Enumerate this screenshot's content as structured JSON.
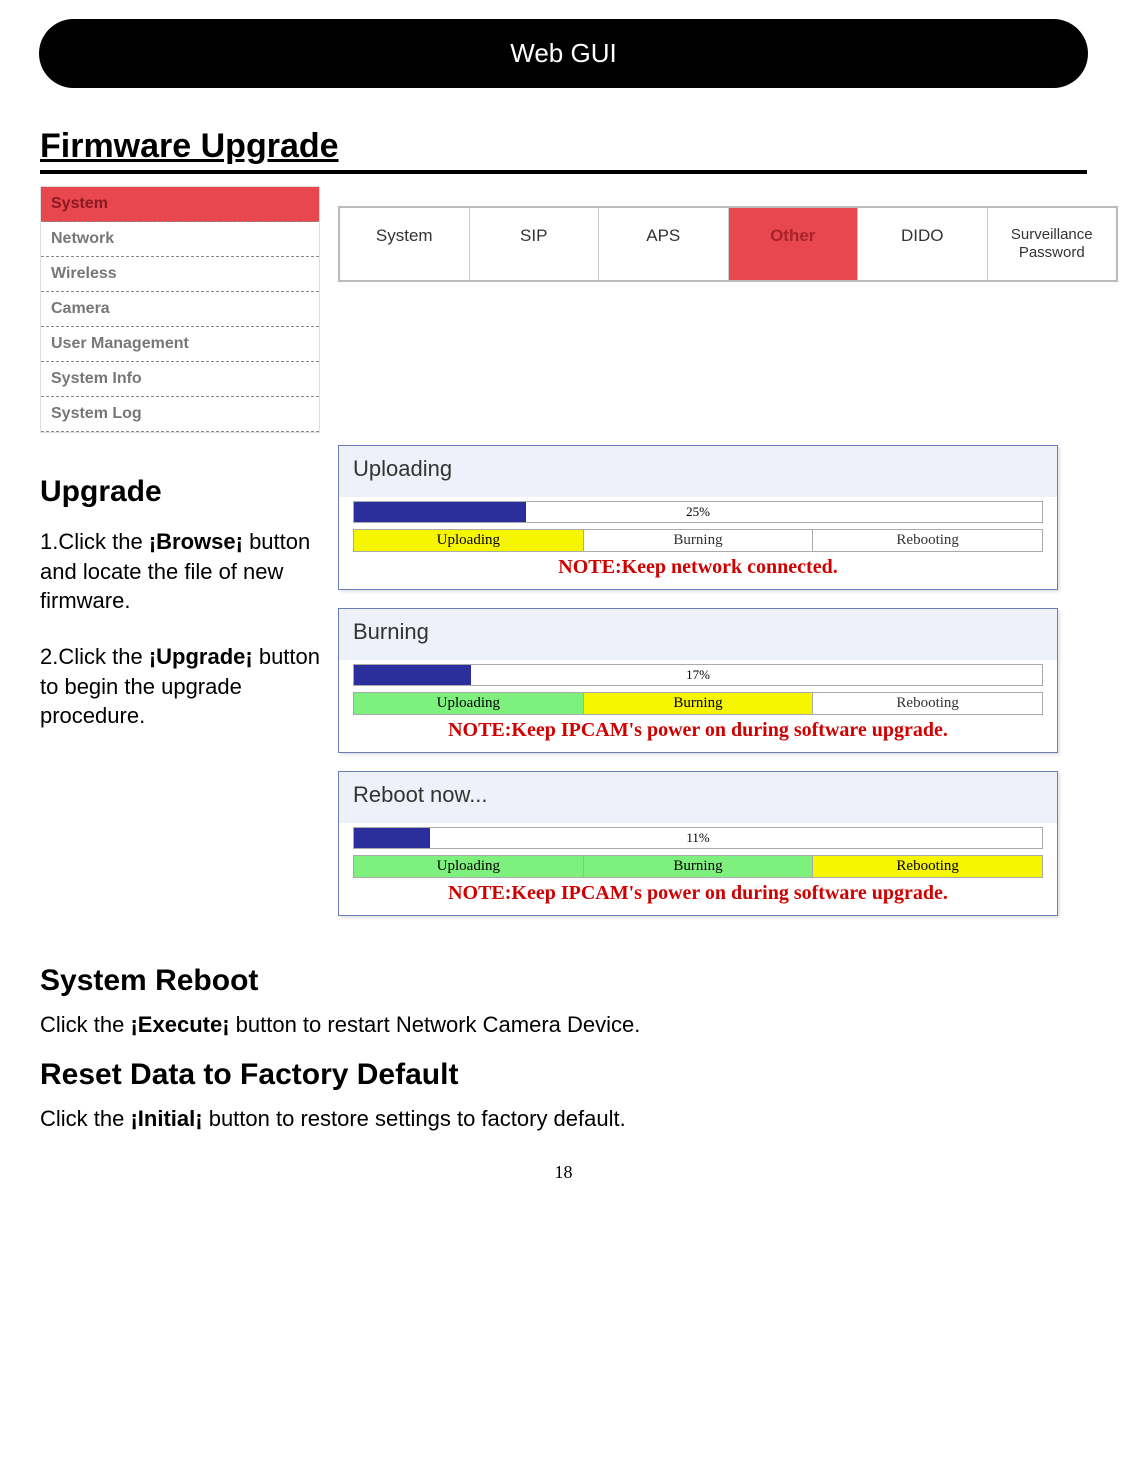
{
  "header": {
    "title": "Web GUI"
  },
  "section_title": "Firmware Upgrade",
  "sidebar": {
    "items": [
      {
        "label": "System",
        "active": true
      },
      {
        "label": "Network"
      },
      {
        "label": "Wireless"
      },
      {
        "label": "Camera"
      },
      {
        "label": "User Management"
      },
      {
        "label": "System Info"
      },
      {
        "label": "System Log"
      }
    ]
  },
  "tabs": {
    "items": [
      {
        "label": "System"
      },
      {
        "label": "SIP"
      },
      {
        "label": "APS"
      },
      {
        "label": "Other",
        "active": true
      },
      {
        "label": "DIDO"
      },
      {
        "label": "Surveillance Password"
      }
    ]
  },
  "upgrade": {
    "heading": "Upgrade",
    "step1_pre": "1.Click the ",
    "step1_bold": "¡Browse¡",
    "step1_post": " button and locate the file of new firmware.",
    "step2_pre": "2.Click the ",
    "step2_bold": "¡Upgrade¡",
    "step2_post": " button to begin the upgrade procedure."
  },
  "panels": [
    {
      "title": "Uploading",
      "percent_label": "25%",
      "percent_value": 25,
      "stages": [
        {
          "label": "Uploading",
          "class": "stage-yellow"
        },
        {
          "label": "Burning",
          "class": "stage-plain"
        },
        {
          "label": "Rebooting",
          "class": "stage-plain"
        }
      ],
      "note": "NOTE:Keep network connected."
    },
    {
      "title": "Burning",
      "percent_label": "17%",
      "percent_value": 17,
      "stages": [
        {
          "label": "Uploading",
          "class": "stage-green"
        },
        {
          "label": "Burning",
          "class": "stage-yellow"
        },
        {
          "label": "Rebooting",
          "class": "stage-plain"
        }
      ],
      "note": "NOTE:Keep IPCAM's power on during software upgrade."
    },
    {
      "title": "Reboot now...",
      "percent_label": "11%",
      "percent_value": 11,
      "stages": [
        {
          "label": "Uploading",
          "class": "stage-green"
        },
        {
          "label": "Burning",
          "class": "stage-green"
        },
        {
          "label": "Rebooting",
          "class": "stage-yellow"
        }
      ],
      "note": "NOTE:Keep IPCAM's power on during software upgrade."
    }
  ],
  "reboot": {
    "heading": "System Reboot",
    "text_pre": "Click the ",
    "text_bold": "¡Execute¡",
    "text_post": "  button to restart Network Camera Device."
  },
  "reset": {
    "heading": "Reset Data to Factory Default",
    "text_pre": "Click the ",
    "text_bold": "¡Initial¡",
    "text_post": "  button to restore settings to factory default."
  },
  "page_number": "18"
}
